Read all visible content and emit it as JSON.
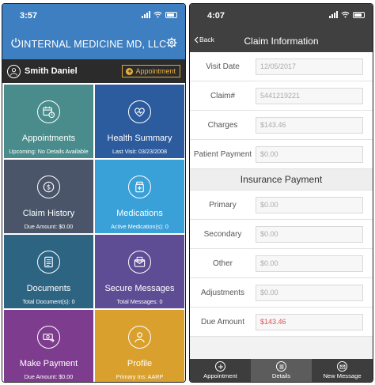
{
  "left": {
    "status_time": "3:57",
    "app_title": "INTERNAL MEDICINE MD, LLC",
    "user_name": "Smith Daniel",
    "appointment_button": "Appointment",
    "tiles": [
      {
        "label": "Appointments",
        "sub": "Upcoming: No Details Available",
        "color": "#4a8c8c",
        "icon": "calendar-clock-icon"
      },
      {
        "label": "Health Summary",
        "sub": "Last Visit: 03/23/2008",
        "color": "#2d5c9e",
        "icon": "heart-doctor-icon"
      },
      {
        "label": "Claim History",
        "sub": "Due Amount: $0.00",
        "color": "#4a556a",
        "icon": "dollar-icon"
      },
      {
        "label": "Medications",
        "sub": "Active Medication(s): 0",
        "color": "#3aa0d8",
        "icon": "pill-bottle-icon"
      },
      {
        "label": "Documents",
        "sub": "Total Document(s): 0",
        "color": "#2d6482",
        "icon": "document-icon"
      },
      {
        "label": "Secure Messages",
        "sub": "Total Messages: 0",
        "color": "#5e4c94",
        "icon": "envelope-icon"
      },
      {
        "label": "Make Payment",
        "sub": "Due Amount: $0.00",
        "color": "#7e3c8e",
        "icon": "payment-icon"
      },
      {
        "label": "Profile",
        "sub": "Primary Ins: AARP",
        "color": "#d9a02e",
        "icon": "profile-icon"
      }
    ]
  },
  "right": {
    "status_time": "4:07",
    "back_label": "Back",
    "nav_title": "Claim Information",
    "fields": [
      {
        "label": "Visit Date",
        "value": "12/05/2017"
      },
      {
        "label": "Claim#",
        "value": "5441219221"
      },
      {
        "label": "Charges",
        "value": "$143.46"
      },
      {
        "label": "Patient Payment",
        "value": "$0.00"
      }
    ],
    "section_title": "Insurance Payment",
    "insurance_fields": [
      {
        "label": "Primary",
        "value": "$0.00"
      },
      {
        "label": "Secondary",
        "value": "$0.00"
      },
      {
        "label": "Other",
        "value": "$0.00"
      },
      {
        "label": "Adjustments",
        "value": "$0.00"
      },
      {
        "label": "Due Amount",
        "value": "$143.46"
      }
    ],
    "tabs": [
      {
        "label": "Appointment",
        "icon": "plus-circle-icon"
      },
      {
        "label": "Details",
        "icon": "list-icon"
      },
      {
        "label": "New Message",
        "icon": "mail-icon"
      }
    ]
  }
}
